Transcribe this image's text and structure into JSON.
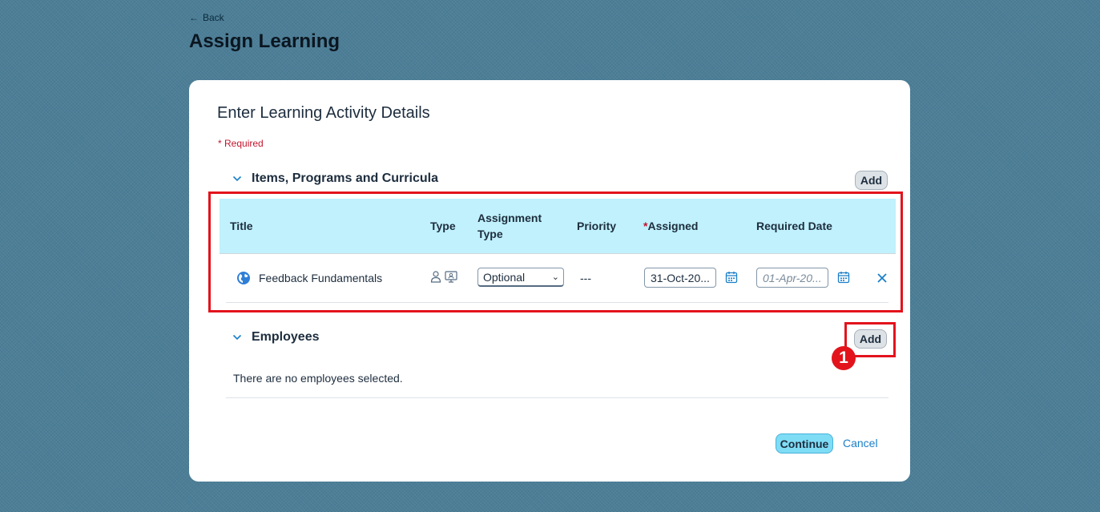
{
  "header": {
    "back_label": "Back",
    "page_title": "Assign Learning"
  },
  "form": {
    "title": "Enter Learning Activity Details",
    "required_note": "* Required"
  },
  "items_section": {
    "title": "Items, Programs and Curricula",
    "add_label": "Add",
    "columns": {
      "title": "Title",
      "type": "Type",
      "assignment_type_line1": "Assignment",
      "assignment_type_line2": "Type",
      "priority": "Priority",
      "assigned_star": "*",
      "assigned": "Assigned",
      "required_date": "Required Date"
    },
    "rows": [
      {
        "title": "Feedback Fundamentals",
        "assignment_type": "Optional",
        "priority": "---",
        "assigned_date": "31-Oct-20...",
        "required_date_placeholder": "01-Apr-20..."
      }
    ]
  },
  "employees_section": {
    "title": "Employees",
    "add_label": "Add",
    "empty_message": "There are no employees selected."
  },
  "footer": {
    "continue_label": "Continue",
    "cancel_label": "Cancel"
  },
  "annotation": {
    "step_number": "1",
    "color": "#e3131c"
  },
  "icons": {
    "back": "arrow-left-icon",
    "section_toggle": "chevron-down-icon",
    "item_type": "globe-icon",
    "type_user": "person-icon",
    "type_online": "monitor-icon",
    "date": "calendar-icon",
    "remove": "close-icon"
  },
  "colors": {
    "background": "#4c7e97",
    "table_header": "#c0f1fc",
    "primary_button": "#7fdcf5",
    "link": "#1b7fc9",
    "required": "#c2152e"
  }
}
